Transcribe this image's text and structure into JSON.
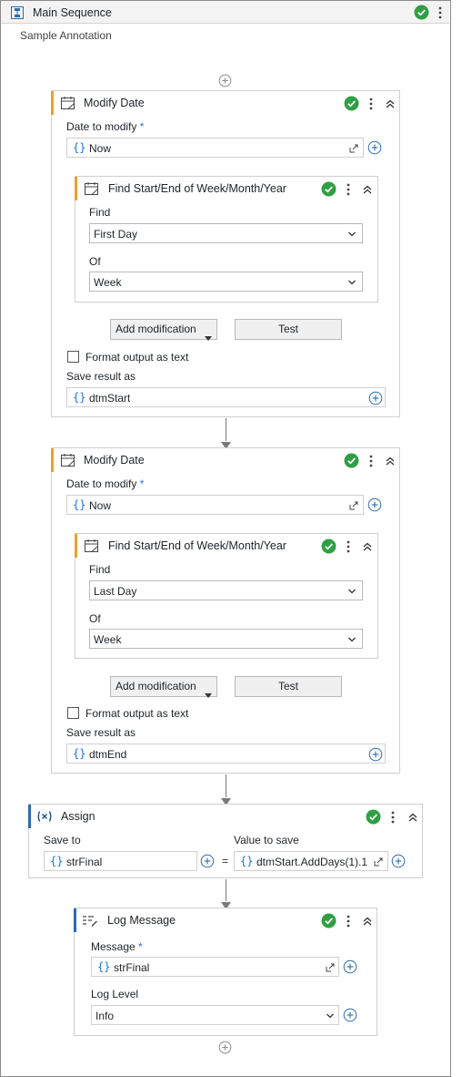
{
  "main": {
    "title": "Main Sequence",
    "annotation": "Sample Annotation"
  },
  "modify1": {
    "title": "Modify Date",
    "date_label": "Date to modify",
    "required_mark": "*",
    "date_value": "Now",
    "find": {
      "title": "Find Start/End of Week/Month/Year",
      "find_label": "Find",
      "find_value": "First Day",
      "of_label": "Of",
      "of_value": "Week"
    },
    "add_mod_label": "Add modification",
    "test_label": "Test",
    "format_label": "Format output as text",
    "save_label": "Save result as",
    "save_value": "dtmStart"
  },
  "modify2": {
    "title": "Modify Date",
    "date_label": "Date to modify",
    "required_mark": "*",
    "date_value": "Now",
    "find": {
      "title": "Find Start/End of Week/Month/Year",
      "find_label": "Find",
      "find_value": "Last Day",
      "of_label": "Of",
      "of_value": "Week"
    },
    "add_mod_label": "Add modification",
    "test_label": "Test",
    "format_label": "Format output as text",
    "save_label": "Save result as",
    "save_value": "dtmEnd"
  },
  "assign": {
    "title": "Assign",
    "save_to_label": "Save to",
    "save_to_value": "strFinal",
    "equals": "=",
    "value_label": "Value to save",
    "value_value": "dtmStart.AddDays(1).1"
  },
  "log": {
    "title": "Log Message",
    "message_label": "Message",
    "required_mark": "*",
    "message_value": "strFinal",
    "level_label": "Log Level",
    "level_value": "Info"
  },
  "curly": "{}",
  "colors": {
    "success": "#2ea043",
    "accent_orange": "#e8a030",
    "accent_blue": "#2b6cb0",
    "link_blue": "#1a73e8"
  },
  "icons": [
    "sequence-icon",
    "success-check-icon",
    "more-vertical-icon",
    "collapse-icon",
    "calendar-icon",
    "expand-icon",
    "add-circle-icon",
    "chevron-down-icon",
    "assign-variable-icon",
    "log-message-icon"
  ]
}
